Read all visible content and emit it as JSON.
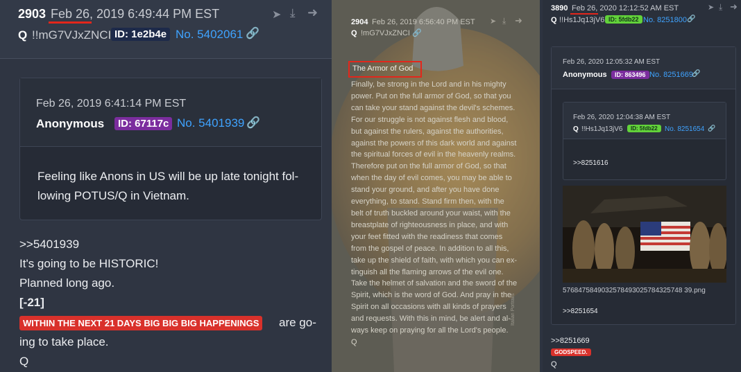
{
  "left": {
    "post_number": "2903",
    "date": "Feb 26, 2019 6:49:44 PM EST",
    "author": "Q",
    "tripcode": "!!mG7VJxZNCI",
    "id": "ID: 1e2b4e",
    "post_no": "No. 5402061",
    "quoted": {
      "date": "Feb 26, 2019 6:41:14 PM EST",
      "author": "Anonymous",
      "id": "ID: 67117c",
      "post_no": "No. 5401939",
      "text_line1": "Feeling like Anons in US will be up late tonight fol-",
      "text_line2": "lowing POTUS/Q in Vietnam."
    },
    "body": {
      "ref": ">>5401939",
      "line1": "It's going to be HISTORIC!",
      "line2": "Planned long ago.",
      "line3": "[-21]",
      "highlight": "WITHIN THE NEXT 21 DAYS BIG BIG BIG HAPPENINGS",
      "after_highlight": "are go-",
      "line5": "ing to take place.",
      "sign": "Q"
    }
  },
  "middle": {
    "post_number": "2904",
    "date": "Feb 26, 2019 6:56:40 PM EST",
    "author": "Q",
    "tripcode": "!mG7VJxZNCI",
    "title": "The Armor of God",
    "lines": [
      "Finally, be strong in the Lord and in his mighty",
      "power. Put on the full armor of God, so that you",
      "can take your stand against the devil's schemes.",
      "For our struggle is not against flesh and blood,",
      "but against the rulers, against the authorities,",
      "against the powers of this dark world and against",
      "the spiritual forces of evil in the heavenly realms.",
      "Therefore put on the full armor of God, so that",
      "when the day of evil comes, you may be able to",
      "stand your ground, and after you have done",
      "everything, to stand. Stand firm then, with the",
      "belt of truth buckled around your waist, with the",
      "breastplate of righteousness in place, and with",
      "your feet fitted with the readiness that comes",
      "from the gospel of peace. In addition to all this,",
      "take up the shield of faith, with which you can ex-",
      "tinguish all the flaming arrows of the evil one.",
      "Take the helmet of salvation and the sword of the",
      "Spirit, which is the word of God. And pray in the",
      "Spirit on all occasions with all kinds of prayers",
      "and requests. With this in mind, be alert and al-",
      "ways keep on praying for all the Lord's people."
    ],
    "sign": "Q",
    "watermark": "Italian Portraits"
  },
  "right": {
    "post_number": "3890",
    "date": "Feb 26, 2020 12:12:52 AM EST",
    "author": "Q",
    "tripcode": "!!Hs1Jq13jV6",
    "id": "ID: 5fdb22",
    "post_no": "No. 8251800",
    "quoted": {
      "date": "Feb 26, 2020 12:05:32 AM EST",
      "author": "Anonymous",
      "id": "ID: 863496",
      "post_no": "No. 8251669",
      "inner": {
        "date": "Feb 26, 2020 12:04:38 AM EST",
        "author": "Q",
        "tripcode": "!!Hs1Jq13jV6",
        "id": "ID: 5fdb22",
        "post_no": "No. 8251654",
        "ref": ">>8251616"
      },
      "filename": "5768475849032578493025784325748 39.png",
      "ref": ">>8251654"
    },
    "body": {
      "ref": ">>8251669",
      "tag": "GODSPEED.",
      "sign": "Q"
    }
  }
}
